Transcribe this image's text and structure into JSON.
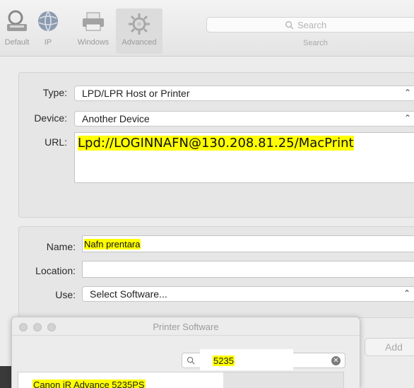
{
  "toolbar": {
    "buttons": [
      {
        "label": "Default",
        "icon": "magnifier-printer-icon"
      },
      {
        "label": "IP",
        "icon": "globe-icon"
      },
      {
        "label": "Windows",
        "icon": "printer-icon"
      },
      {
        "label": "Advanced",
        "icon": "gear-icon"
      }
    ],
    "search": {
      "placeholder": "Search",
      "label": "Search"
    }
  },
  "connection": {
    "type_label": "Type:",
    "type_value": "LPD/LPR Host or Printer",
    "device_label": "Device:",
    "device_value": "Another Device",
    "url_label": "URL:",
    "url_value": "Lpd://LOGINNAFN@130.208.81.25/MacPrint"
  },
  "printer": {
    "name_label": "Name:",
    "name_value": "Nafn prentara",
    "location_label": "Location:",
    "location_value": "",
    "use_label": "Use:",
    "use_value": "Select Software..."
  },
  "add_button": "Add",
  "software_sheet": {
    "title": "Printer Software",
    "search_value": "5235",
    "results": [
      "Canon iR Advance 5235PS"
    ]
  },
  "colors": {
    "highlight": "#ffff00",
    "background": "#ececec"
  }
}
